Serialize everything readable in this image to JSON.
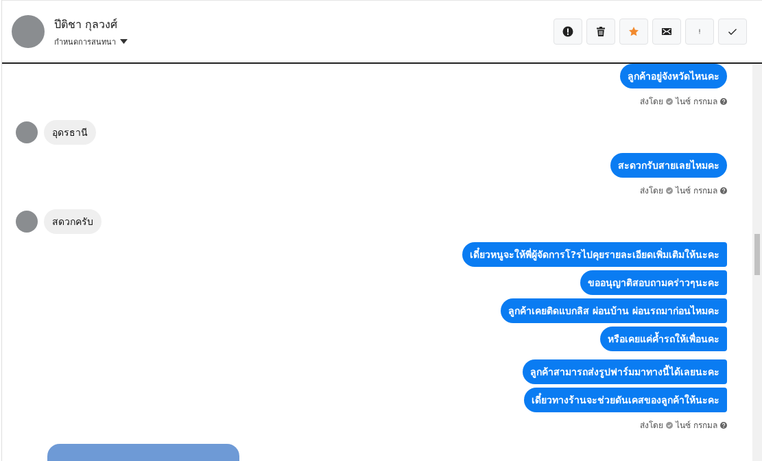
{
  "contact": {
    "name": "ปีติชา กุลวงศ์",
    "subtitle": "กำหนดการสนทนา"
  },
  "actions": [
    {
      "kind": "alert",
      "on": false
    },
    {
      "kind": "trash",
      "on": false
    },
    {
      "kind": "star",
      "on": true
    },
    {
      "kind": "mail",
      "on": false
    },
    {
      "kind": "important",
      "on": false
    },
    {
      "kind": "done",
      "on": false
    }
  ],
  "messages": [
    {
      "kind": "outgoing",
      "texts": [
        "ลูกค้าอยู่จังหวัดไหนคะ"
      ]
    },
    {
      "kind": "meta",
      "prefix": "ส่งโดย",
      "agent": "ไนซ์ กรกมล"
    },
    {
      "kind": "incoming",
      "texts": [
        "อุดรธานี"
      ]
    },
    {
      "kind": "outgoing",
      "texts": [
        "สะดวกรับสายเลยไหมคะ"
      ]
    },
    {
      "kind": "meta",
      "prefix": "ส่งโดย",
      "agent": "ไนซ์ กรกมล"
    },
    {
      "kind": "incoming",
      "texts": [
        "สดวกครับ"
      ]
    },
    {
      "kind": "outgoing",
      "texts": [
        "เดี๋ยวหนูจะให้พี่ผู้จัดการโ?รไปคุยรายละเอียดเพิ่มเติมให้นะคะ",
        "ขออนุญาติสอบถามคร่าวๆนะคะ",
        "ลูกค้าเคยติดแบกลิส ผ่อนบ้าน ผ่อนรถมาก่อนไหมคะ",
        "หรือเคยแค่ค้ำรถให้เพื่อนคะ"
      ]
    },
    {
      "kind": "outgoing",
      "texts": [
        "ลูกค้าสามารถส่งรูปฟาร์มมาทางนี้ได้เลยนะคะ",
        "เดี๋ยวทางร้านจะช่วยดันเคสของลูกค้าให้นะคะ"
      ]
    },
    {
      "kind": "meta",
      "prefix": "ส่งโดย",
      "agent": "ไนซ์ กรกมล"
    },
    {
      "kind": "photo"
    }
  ]
}
